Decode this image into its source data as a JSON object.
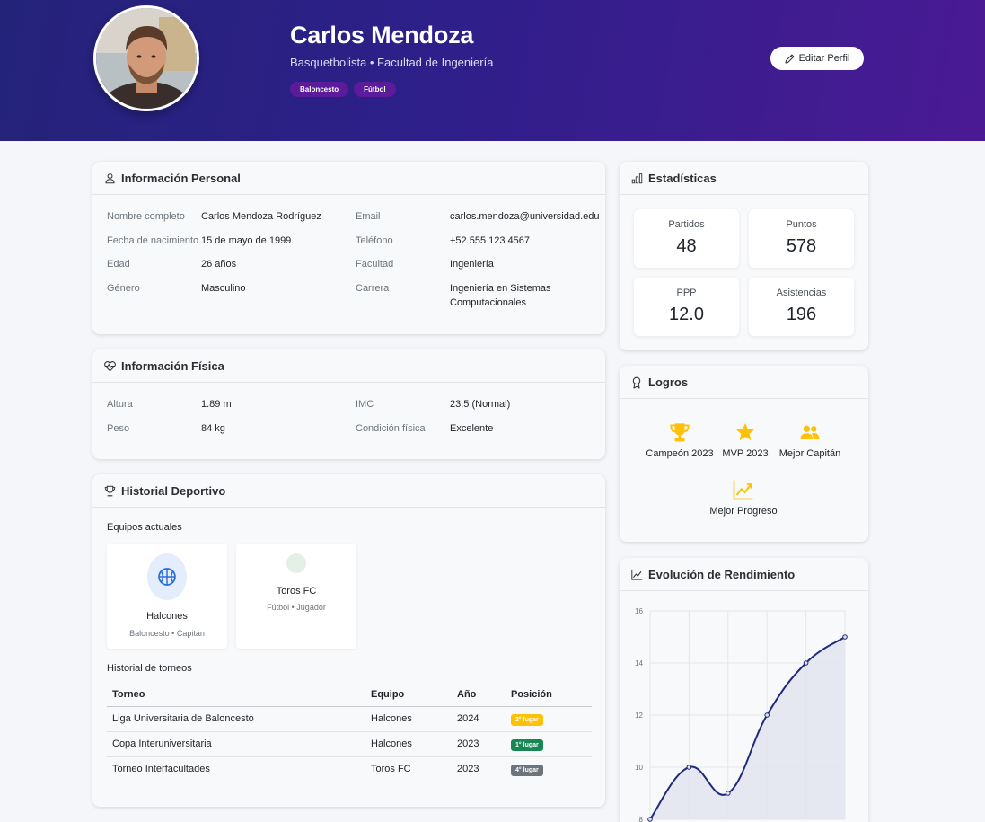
{
  "profile": {
    "name": "Carlos Mendoza",
    "subtitle": "Basquetbolista • Facultad de Ingeniería",
    "tags": [
      "Baloncesto",
      "Fútbol"
    ],
    "edit_label": "Editar Perfil"
  },
  "personal": {
    "title": "Información Personal",
    "left": [
      {
        "label": "Nombre completo",
        "value": "Carlos Mendoza Rodríguez"
      },
      {
        "label": "Fecha de nacimiento",
        "value": "15 de mayo de 1999"
      },
      {
        "label": "Edad",
        "value": "26 años"
      },
      {
        "label": "Género",
        "value": "Masculino"
      }
    ],
    "right": [
      {
        "label": "Email",
        "value": "carlos.mendoza@universidad.edu"
      },
      {
        "label": "Teléfono",
        "value": "+52 555 123 4567"
      },
      {
        "label": "Facultad",
        "value": "Ingeniería"
      },
      {
        "label": "Carrera",
        "value": "Ingeniería en Sistemas Computacionales"
      }
    ]
  },
  "physical": {
    "title": "Información Física",
    "left": [
      {
        "label": "Altura",
        "value": "1.89 m"
      },
      {
        "label": "Peso",
        "value": "84 kg"
      }
    ],
    "right": [
      {
        "label": "IMC",
        "value": "23.5 (Normal)"
      },
      {
        "label": "Condición física",
        "value": "Excelente"
      }
    ]
  },
  "history": {
    "title": "Historial Deportivo",
    "teams_label": "Equipos actuales",
    "teams": [
      {
        "name": "Halcones",
        "meta": "Baloncesto • Capitán"
      },
      {
        "name": "Toros FC",
        "meta": "Fútbol • Jugador"
      }
    ],
    "tournaments_label": "Historial de torneos",
    "columns": [
      "Torneo",
      "Equipo",
      "Año",
      "Posición"
    ],
    "rows": [
      {
        "torneo": "Liga Universitaria de Baloncesto",
        "equipo": "Halcones",
        "anio": "2024",
        "posicion": "2° lugar",
        "badge_color": "#ffc107",
        "badge_text_color": "#ffffff"
      },
      {
        "torneo": "Copa Interuniversitaria",
        "equipo": "Halcones",
        "anio": "2023",
        "posicion": "1° lugar",
        "badge_color": "#198754",
        "badge_text_color": "#ffffff"
      },
      {
        "torneo": "Torneo Interfacultades",
        "equipo": "Toros FC",
        "anio": "2023",
        "posicion": "4° lugar",
        "badge_color": "#6c757d",
        "badge_text_color": "#ffffff"
      }
    ]
  },
  "stats": {
    "title": "Estadísticas",
    "items": [
      {
        "label": "Partidos",
        "value": "48"
      },
      {
        "label": "Puntos",
        "value": "578"
      },
      {
        "label": "PPP",
        "value": "12.0"
      },
      {
        "label": "Asistencias",
        "value": "196"
      }
    ]
  },
  "achievements": {
    "title": "Logros",
    "items": [
      {
        "label": "Campeón 2023",
        "icon": "trophy-icon"
      },
      {
        "label": "MVP 2023",
        "icon": "star-icon"
      },
      {
        "label": "Mejor Capitán",
        "icon": "people-icon"
      },
      {
        "label": "Mejor Progreso",
        "icon": "graph-up-icon"
      }
    ]
  },
  "performance": {
    "title": "Evolución de Rendimiento"
  },
  "colors": {
    "hero_start": "#24237a",
    "hero_end": "#4a1a94",
    "tag_bg": "#5b1b9b",
    "achievement_gold": "#ffc107",
    "chart_line": "#1f2a7a",
    "chart_fill": "#e2e4ee"
  },
  "chart_data": {
    "type": "area",
    "x": [
      1,
      2,
      3,
      4,
      5,
      6
    ],
    "series": [
      {
        "values": [
          8,
          10,
          9,
          12,
          14,
          15
        ]
      }
    ],
    "yticks": [
      "8",
      "10",
      "12",
      "14",
      "16"
    ],
    "ylim": [
      8,
      16
    ],
    "grid": true
  }
}
